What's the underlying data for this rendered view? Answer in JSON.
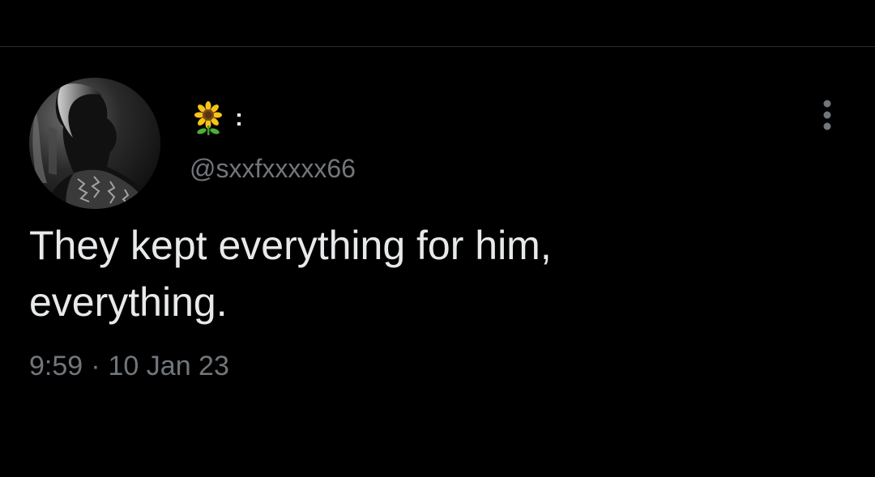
{
  "colors": {
    "background": "#000000",
    "text_primary": "#e7e9ea",
    "text_secondary": "#71767b",
    "divider": "#2a2d30"
  },
  "tweet": {
    "display_name": ":",
    "display_name_emoji": "sunflower-icon",
    "handle": "@sxxfxxxxx66",
    "text": "They kept everything for him,\neverything.",
    "time": "9:59",
    "separator": "·",
    "date": "10 Jan 23",
    "more_icon": "more-vertical-icon"
  }
}
